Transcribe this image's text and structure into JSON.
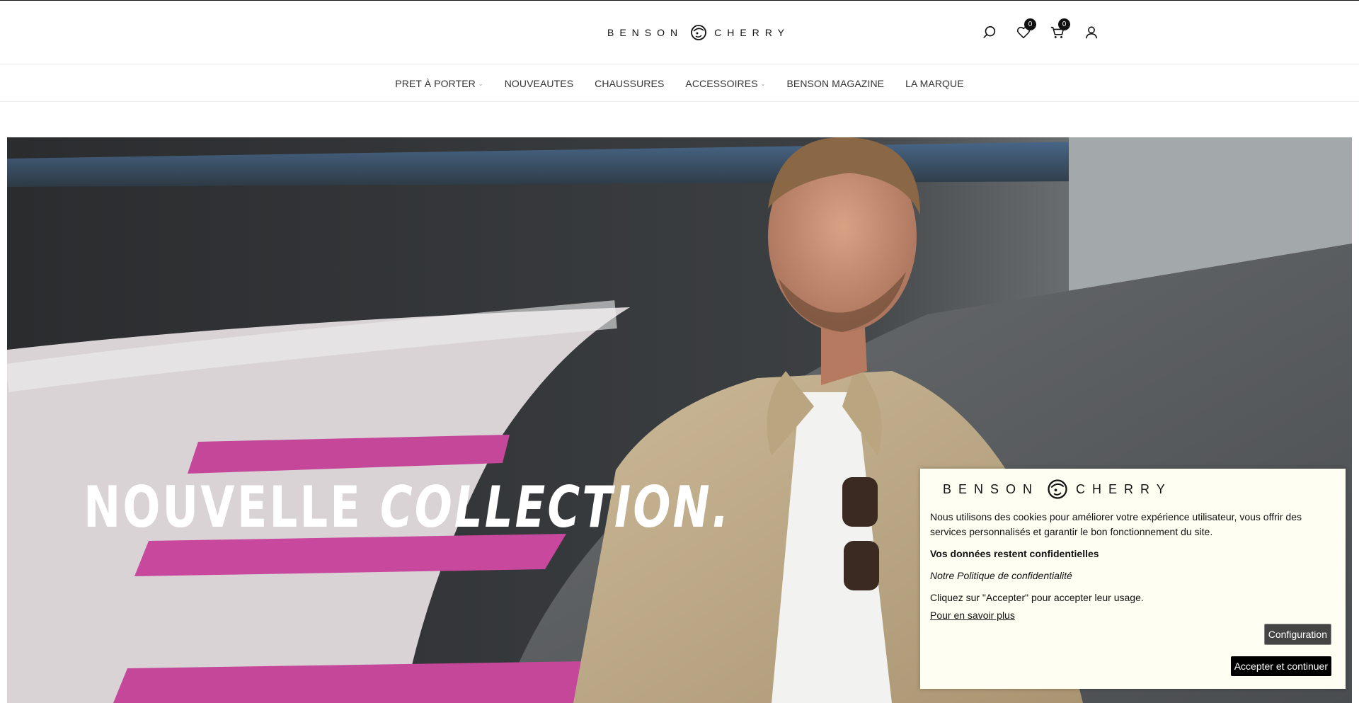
{
  "header": {
    "logo_left": "BENSON",
    "logo_right": "CHERRY",
    "wishlist_count": "0",
    "cart_count": "0"
  },
  "nav": {
    "items": [
      {
        "label": "PRET À PORTER",
        "has_dropdown": true
      },
      {
        "label": "NOUVEAUTES",
        "has_dropdown": false
      },
      {
        "label": "CHAUSSURES",
        "has_dropdown": false
      },
      {
        "label": "ACCESSOIRES",
        "has_dropdown": true
      },
      {
        "label": "BENSON MAGAZINE",
        "has_dropdown": false
      },
      {
        "label": "LA MARQUE",
        "has_dropdown": false
      }
    ]
  },
  "hero": {
    "title_plain": "NOUVELLE",
    "title_italic": "COLLECTION."
  },
  "cookie": {
    "logo_left": "BENSON",
    "logo_right": "CHERRY",
    "text": "Nous utilisons des cookies pour améliorer votre expérience utilisateur, vous offrir des services personnalisés et garantir le bon fonctionnement du site.",
    "strong": "Vos données restent confidentielles",
    "policy": "Notre Politique de confidentialité",
    "accept_hint": "Cliquez sur \"Accepter\" pour accepter leur usage.",
    "more_link": "Pour en savoir plus",
    "config_button": "Configuration",
    "accept_button": "Accepter et continuer"
  },
  "colors": {
    "accent": "#111111",
    "cookie_bg": "#fffef2"
  }
}
